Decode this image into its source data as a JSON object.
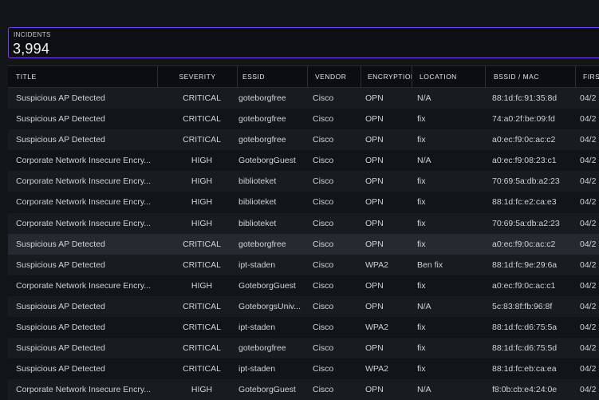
{
  "kpi": {
    "label": "INCIDENTS",
    "value": "3,994"
  },
  "table": {
    "columns": [
      "TITLE",
      "SEVERITY",
      "ESSID",
      "VENDOR",
      "ENCRYPTION",
      "LOCATION",
      "BSSID / MAC",
      "FIRS"
    ],
    "rows": [
      {
        "title": "Suspicious AP Detected",
        "severity": "CRITICAL",
        "essid": "goteborgfree",
        "vendor": "Cisco",
        "encryption": "OPN",
        "location": "N/A",
        "bssid": "88:1d:fc:91:35:8d",
        "first": "04/2"
      },
      {
        "title": "Suspicious AP Detected",
        "severity": "CRITICAL",
        "essid": "goteborgfree",
        "vendor": "Cisco",
        "encryption": "OPN",
        "location": "fix",
        "bssid": "74:a0:2f:be:09:fd",
        "first": "04/2"
      },
      {
        "title": "Suspicious AP Detected",
        "severity": "CRITICAL",
        "essid": "goteborgfree",
        "vendor": "Cisco",
        "encryption": "OPN",
        "location": "fix",
        "bssid": "a0:ec:f9:0c:ac:c2",
        "first": "04/2"
      },
      {
        "title": "Corporate Network Insecure Encry...",
        "severity": "HIGH",
        "essid": "GoteborgGuest",
        "vendor": "Cisco",
        "encryption": "OPN",
        "location": "N/A",
        "bssid": "a0:ec:f9:08:23:c1",
        "first": "04/2"
      },
      {
        "title": "Corporate Network Insecure Encry...",
        "severity": "HIGH",
        "essid": "biblioteket",
        "vendor": "Cisco",
        "encryption": "OPN",
        "location": "fix",
        "bssid": "70:69:5a:db:a2:23",
        "first": "04/2"
      },
      {
        "title": "Corporate Network Insecure Encry...",
        "severity": "HIGH",
        "essid": "biblioteket",
        "vendor": "Cisco",
        "encryption": "OPN",
        "location": "fix",
        "bssid": "88:1d:fc:e2:ca:e3",
        "first": "04/2"
      },
      {
        "title": "Corporate Network Insecure Encry...",
        "severity": "HIGH",
        "essid": "biblioteket",
        "vendor": "Cisco",
        "encryption": "OPN",
        "location": "fix",
        "bssid": "70:69:5a:db:a2:23",
        "first": "04/2"
      },
      {
        "title": "Suspicious AP Detected",
        "severity": "CRITICAL",
        "essid": "goteborgfree",
        "vendor": "Cisco",
        "encryption": "OPN",
        "location": "fix",
        "bssid": "a0:ec:f9:0c:ac:c2",
        "first": "04/2"
      },
      {
        "title": "Suspicious AP Detected",
        "severity": "CRITICAL",
        "essid": "ipt-staden",
        "vendor": "Cisco",
        "encryption": "WPA2",
        "location": "Ben fix",
        "bssid": "88:1d:fc:9e:29:6a",
        "first": "04/2"
      },
      {
        "title": "Corporate Network Insecure Encry...",
        "severity": "HIGH",
        "essid": "GoteborgGuest",
        "vendor": "Cisco",
        "encryption": "OPN",
        "location": "fix",
        "bssid": "a0:ec:f9:0c:ac:c1",
        "first": "04/2"
      },
      {
        "title": "Suspicious AP Detected",
        "severity": "CRITICAL",
        "essid": "GoteborgsUniv...",
        "vendor": "Cisco",
        "encryption": "OPN",
        "location": "N/A",
        "bssid": "5c:83:8f:fb:96:8f",
        "first": "04/2"
      },
      {
        "title": "Suspicious AP Detected",
        "severity": "CRITICAL",
        "essid": "ipt-staden",
        "vendor": "Cisco",
        "encryption": "WPA2",
        "location": "fix",
        "bssid": "88:1d:fc:d6:75:5a",
        "first": "04/2"
      },
      {
        "title": "Suspicious AP Detected",
        "severity": "CRITICAL",
        "essid": "goteborgfree",
        "vendor": "Cisco",
        "encryption": "OPN",
        "location": "fix",
        "bssid": "88:1d:fc:d6:75:5d",
        "first": "04/2"
      },
      {
        "title": "Suspicious AP Detected",
        "severity": "CRITICAL",
        "essid": "ipt-staden",
        "vendor": "Cisco",
        "encryption": "WPA2",
        "location": "fix",
        "bssid": "88:1d:fc:eb:ca:ea",
        "first": "04/2"
      },
      {
        "title": "Corporate Network Insecure Encry...",
        "severity": "HIGH",
        "essid": "GoteborgGuest",
        "vendor": "Cisco",
        "encryption": "OPN",
        "location": "N/A",
        "bssid": "f8:0b:cb:e4:24:0e",
        "first": "04/2"
      }
    ],
    "highlighted_row": 7
  }
}
